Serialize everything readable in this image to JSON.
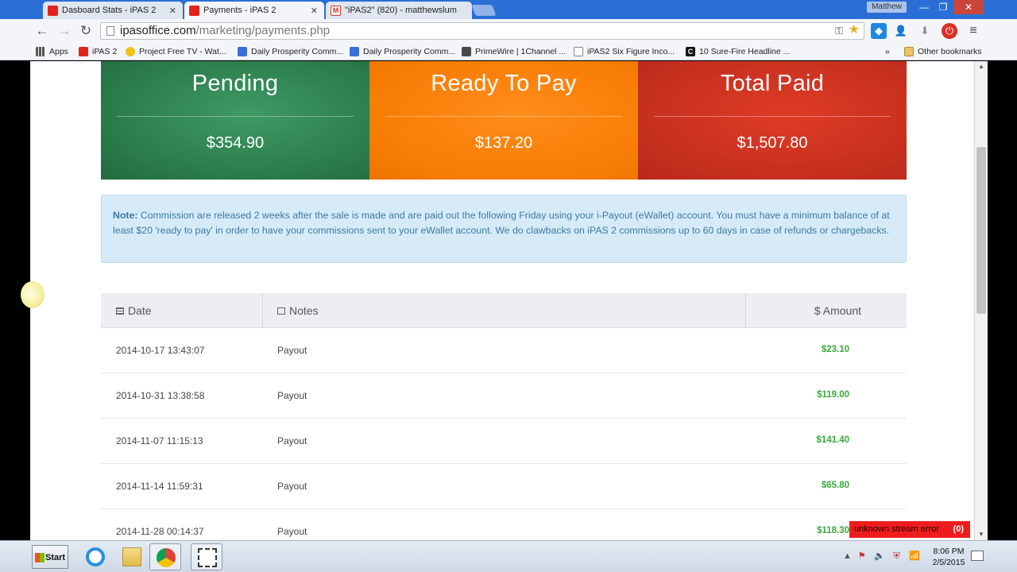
{
  "browser": {
    "tabs": [
      {
        "title": "Dasboard Stats - iPAS 2",
        "active": false,
        "favicon_color": "#e2231a"
      },
      {
        "title": "Payments - iPAS 2",
        "active": true,
        "favicon_color": "#e2231a"
      },
      {
        "title": "\"iPAS2\" (820) - matthewslum",
        "active": false,
        "favicon_color": "#d93025"
      }
    ],
    "profile_name": "Matthew",
    "url_host": "ipasoffice.com",
    "url_path": "/marketing/payments.php",
    "bookmarks": [
      {
        "label": "Apps",
        "icon": "apps-grid-icon"
      },
      {
        "label": "iPAS 2",
        "icon": "ipas-icon"
      },
      {
        "label": "Project Free TV - Wat...",
        "icon": "smiley-icon"
      },
      {
        "label": "Daily Prosperity Comm...",
        "icon": "doc-icon"
      },
      {
        "label": "Daily Prosperity Comm...",
        "icon": "doc-icon"
      },
      {
        "label": "PrimeWire | 1Channel ...",
        "icon": "film-icon"
      },
      {
        "label": "iPAS2 Six Figure Inco...",
        "icon": "page-icon"
      },
      {
        "label": "10 Sure-Fire Headline ...",
        "icon": "c-icon"
      }
    ],
    "bookmarks_overflow": "»",
    "other_bookmarks": "Other bookmarks"
  },
  "summary": {
    "pending": {
      "label": "Pending",
      "value": "$354.90"
    },
    "ready": {
      "label": "Ready To Pay",
      "value": "$137.20"
    },
    "paid": {
      "label": "Total Paid",
      "value": "$1,507.80"
    }
  },
  "note": {
    "prefix": "Note:",
    "text": " Commission are released 2 weeks after the sale is made and are paid out the following Friday using your i-Payout (eWallet) account. You must have a minimum balance of at least $20 'ready to pay' in order to have your commissions sent to your eWallet account. We do clawbacks on iPAS 2 commissions up to 60 days in case of refunds or chargebacks."
  },
  "table": {
    "headers": {
      "date": "Date",
      "notes": "Notes",
      "amount": "$ Amount"
    },
    "rows": [
      {
        "date": "2014-10-17 13:43:07",
        "note": "Payout",
        "amount": "$23.10"
      },
      {
        "date": "2014-10-31 13:38:58",
        "note": "Payout",
        "amount": "$119.00"
      },
      {
        "date": "2014-11-07 11:15:13",
        "note": "Payout",
        "amount": "$141.40"
      },
      {
        "date": "2014-11-14 11:59:31",
        "note": "Payout",
        "amount": "$65.80"
      },
      {
        "date": "2014-11-28 00:14:37",
        "note": "Payout",
        "amount": "$118.30"
      }
    ]
  },
  "error_badge": {
    "text": "unknown stream error",
    "count": "(0)"
  },
  "taskbar": {
    "start_label": "Start",
    "clock_time": "8:06 PM",
    "clock_date": "2/5/2015"
  },
  "colors": {
    "pending": "#2a7a4a",
    "ready": "#f77d05",
    "paid": "#c5301e",
    "amount_green": "#3aa83a",
    "note_bg": "#d6ebf7"
  }
}
